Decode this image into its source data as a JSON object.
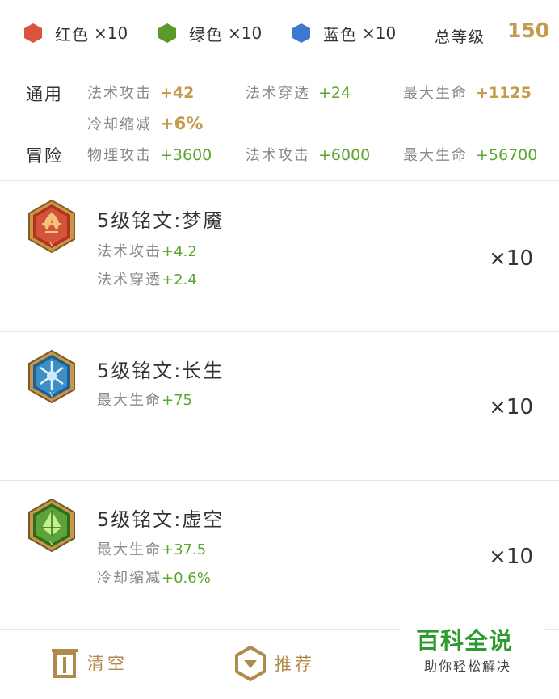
{
  "colors": {
    "red": "#d9533f",
    "green": "#5a9a2c",
    "blue": "#3f78d0",
    "gold": "#c49a4c",
    "stat_green": "#5aa62e"
  },
  "summary": {
    "red": {
      "label": "红色",
      "count": "×10"
    },
    "green": {
      "label": "绿色",
      "count": "×10"
    },
    "blue": {
      "label": "蓝色",
      "count": "×10"
    },
    "total_label": "总等级",
    "total_value": "150"
  },
  "stats": {
    "general": {
      "label": "通用",
      "items": [
        {
          "name": "法术攻击",
          "value": "+42"
        },
        {
          "name": "法术穿透",
          "value": "+24"
        },
        {
          "name": "最大生命",
          "value": "+1125"
        },
        {
          "name": "冷却缩减",
          "value": "+6%"
        }
      ]
    },
    "adventure": {
      "label": "冒险",
      "items": [
        {
          "name": "物理攻击",
          "value": "+3600"
        },
        {
          "name": "法术攻击",
          "value": "+6000"
        },
        {
          "name": "最大生命",
          "value": "+56700"
        }
      ]
    }
  },
  "runes": [
    {
      "icon": "red-rune-icon",
      "title": "5级铭文:梦魇",
      "stats": [
        {
          "name": "法术攻击",
          "value": "+4.2"
        },
        {
          "name": "法术穿透",
          "value": "+2.4"
        }
      ],
      "count": "×10"
    },
    {
      "icon": "blue-rune-icon",
      "title": "5级铭文:长生",
      "stats": [
        {
          "name": "最大生命",
          "value": "+75"
        }
      ],
      "count": "×10"
    },
    {
      "icon": "green-rune-icon",
      "title": "5级铭文:虚空",
      "stats": [
        {
          "name": "最大生命",
          "value": "+37.5"
        },
        {
          "name": "冷却缩减",
          "value": "+0.6%"
        }
      ],
      "count": "×10"
    }
  ],
  "bottom": {
    "clear_label": "清空",
    "recommend_label": "推荐"
  },
  "watermark": {
    "title": "百科全说",
    "subtitle": "助你轻松解决"
  }
}
